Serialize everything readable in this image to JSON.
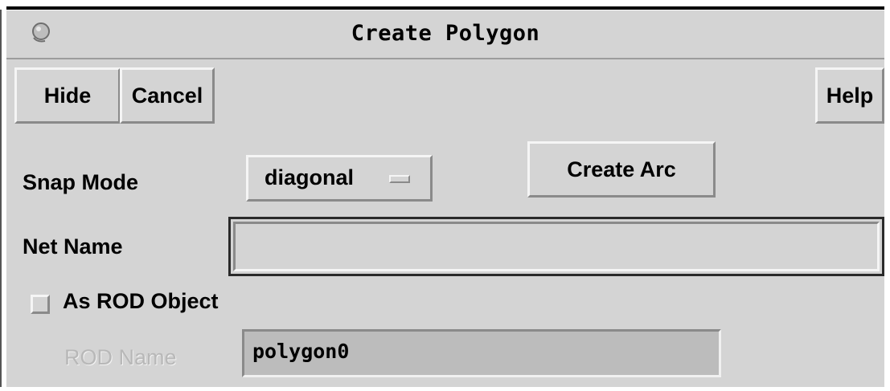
{
  "window": {
    "title": "Create Polygon"
  },
  "toolbar": {
    "hide_label": "Hide",
    "cancel_label": "Cancel",
    "help_label": "Help"
  },
  "form": {
    "snap_mode_label": "Snap Mode",
    "snap_mode_value": "diagonal",
    "create_arc_label": "Create Arc",
    "net_name_label": "Net Name",
    "net_name_value": "",
    "as_rod_object_label": "As ROD Object",
    "as_rod_object_checked": false,
    "rod_name_label": "ROD Name",
    "rod_name_value": "polygon0"
  },
  "icons": {
    "title_icon": "window-menu-icon",
    "snap_indicator": "option-menu-indicator-icon"
  }
}
